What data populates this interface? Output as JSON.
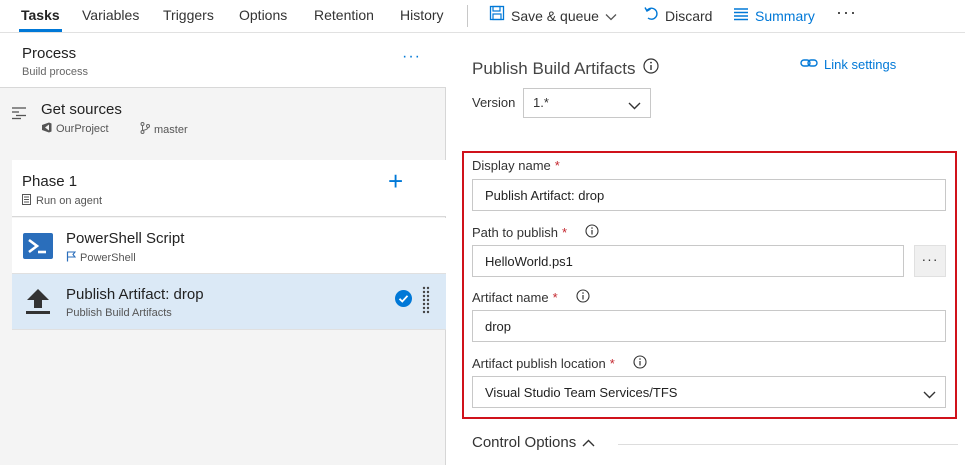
{
  "toolbar": {
    "tabs": [
      {
        "label": "Tasks",
        "active": true
      },
      {
        "label": "Variables"
      },
      {
        "label": "Triggers"
      },
      {
        "label": "Options"
      },
      {
        "label": "Retention"
      },
      {
        "label": "History"
      }
    ],
    "save_label": "Save & queue",
    "discard_label": "Discard",
    "summary_label": "Summary",
    "more_label": "···",
    "accent_color": "#0078d7"
  },
  "left": {
    "process": {
      "title": "Process",
      "subtitle": "Build process",
      "more": "···"
    },
    "get_sources": {
      "title": "Get sources",
      "project": "OurProject",
      "branch": "master"
    },
    "phase": {
      "title": "Phase 1",
      "subtitle": "Run on agent",
      "add": "+"
    },
    "tasks": [
      {
        "title": "PowerShell Script",
        "subtitle": "PowerShell",
        "icon": "powershell-icon"
      },
      {
        "title": "Publish Artifact: drop",
        "subtitle": "Publish Build Artifacts",
        "icon": "upload-icon",
        "selected": true
      }
    ]
  },
  "right": {
    "title": "Publish Build Artifacts",
    "link_settings": "Link settings",
    "version_label": "Version",
    "version_value": "1.*",
    "fields": {
      "display_name": {
        "label": "Display name",
        "required": "*",
        "value": "Publish Artifact: drop"
      },
      "path": {
        "label": "Path to publish",
        "required": "*",
        "value": "HelloWorld.ps1",
        "browse": "···"
      },
      "artifact_name": {
        "label": "Artifact name",
        "required": "*",
        "value": "drop"
      },
      "location": {
        "label": "Artifact publish location",
        "required": "*",
        "value": "Visual Studio Team Services/TFS"
      }
    },
    "control_options": "Control Options",
    "highlight_color": "#d0121b"
  }
}
